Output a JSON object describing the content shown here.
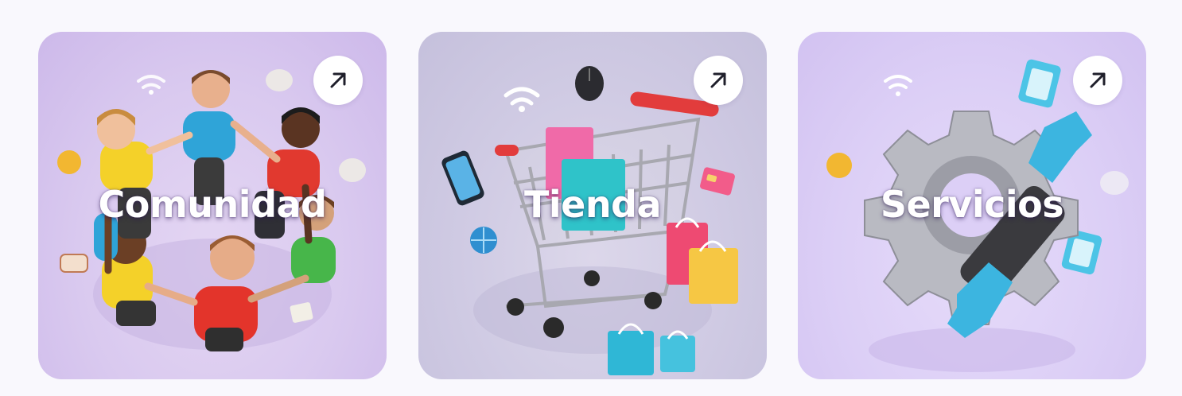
{
  "cards": [
    {
      "title": "Comunidad",
      "icon": "arrow-up-right-icon",
      "image": "community-people-circle-illustration"
    },
    {
      "title": "Tienda",
      "icon": "arrow-up-right-icon",
      "image": "shopping-cart-illustration"
    },
    {
      "title": "Servicios",
      "icon": "arrow-up-right-icon",
      "image": "gear-wrench-illustration"
    }
  ],
  "colors": {
    "page_bg": "#f9f8fd",
    "card_1_bg": "#d9c9ef",
    "card_2_bg": "#cfcae3",
    "card_3_bg": "#dccff6",
    "arrow_button_bg": "#ffffff",
    "arrow_icon": "#1f1f2b"
  }
}
